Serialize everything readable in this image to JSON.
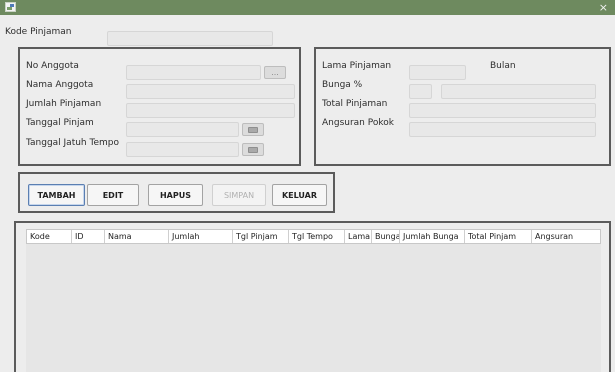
{
  "window": {
    "title": "",
    "close_glyph": "×"
  },
  "kode_pinjaman": {
    "label": "Kode Pinjaman",
    "value": ""
  },
  "anggota_panel": {
    "no_anggota": {
      "label": "No Anggota",
      "value": "",
      "lookup_label": "..."
    },
    "nama_anggota": {
      "label": "Nama Anggota",
      "value": ""
    },
    "jumlah_pinjaman": {
      "label": "Jumlah Pinjaman",
      "value": ""
    },
    "tanggal_pinjam": {
      "label": "Tanggal Pinjam",
      "value": ""
    },
    "tanggal_jatuh_tempo": {
      "label": "Tanggal Jatuh Tempo",
      "value": ""
    }
  },
  "pinjaman_panel": {
    "lama_pinjaman": {
      "label": "Lama Pinjaman",
      "value": "",
      "unit": "Bulan"
    },
    "bunga": {
      "label": "Bunga %",
      "value": "",
      "value2": ""
    },
    "total_pinjaman": {
      "label": "Total Pinjaman",
      "value": ""
    },
    "angsuran_pokok": {
      "label": "Angsuran Pokok",
      "value": ""
    }
  },
  "buttons": {
    "tambah": "TAMBAH",
    "edit": "EDIT",
    "hapus": "HAPUS",
    "simpan": "SIMPAN",
    "keluar": "KELUAR"
  },
  "table": {
    "columns": [
      "Kode",
      "ID",
      "Nama",
      "Jumlah",
      "Tgl Pinjam",
      "Tgl Tempo",
      "Lama",
      "Bunga",
      "Jumlah Bunga",
      "Total Pinjam",
      "Angsuran"
    ],
    "rows": []
  },
  "icons": {
    "app": "app-icon",
    "close": "close-icon",
    "lookup": "ellipsis-icon",
    "date": "calendar-icon"
  },
  "colors": {
    "titlebar": "#6e8a5f",
    "panel_border": "#5b5b5b",
    "field_bg": "#e8e8e8",
    "primary_border": "#5b7fb2"
  }
}
